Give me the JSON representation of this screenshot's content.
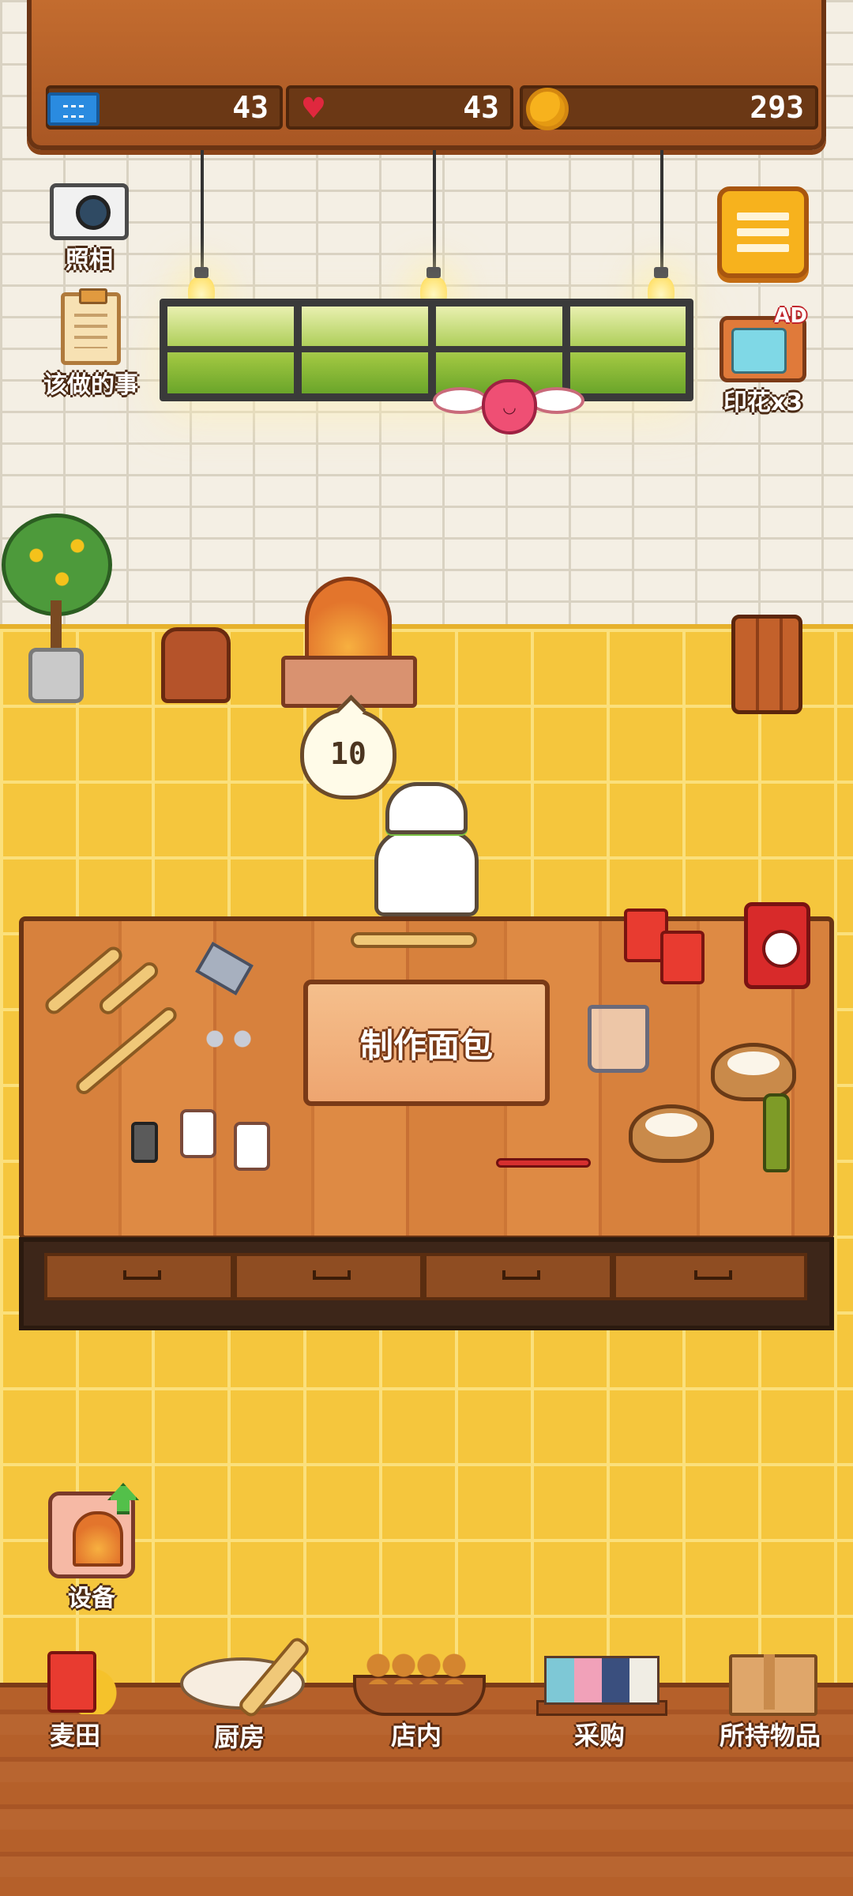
{
  "header": {
    "tickets": "43",
    "hearts": "43",
    "coins": "293"
  },
  "side_buttons": {
    "photo_label": "照相",
    "todo_label": "该做的事",
    "ad_badge": "AD",
    "stamps_label": "印花x3"
  },
  "oven_timer": "10",
  "main_action": {
    "label": "制作面包"
  },
  "equipment": {
    "label": "设备"
  },
  "nav": {
    "items": [
      {
        "label": "麦田",
        "icon": "wheat-field-icon"
      },
      {
        "label": "厨房",
        "icon": "kitchen-icon"
      },
      {
        "label": "店内",
        "icon": "store-icon"
      },
      {
        "label": "采购",
        "icon": "purchase-icon"
      },
      {
        "label": "所持物品",
        "icon": "inventory-icon"
      }
    ]
  },
  "icons": {
    "ticket": "ticket-icon",
    "heart": "heart-icon",
    "coin": "coin-icon",
    "camera": "camera-icon",
    "clipboard": "clipboard-icon",
    "menu": "menu-icon",
    "tv": "tv-ad-icon",
    "upgrade": "upgrade-arrow-icon"
  },
  "colors": {
    "board": "#b55f28",
    "floor": "#f5c63d",
    "menu_button": "#f7b21d",
    "heart": "#ef4f74",
    "ticket": "#2a8be0",
    "coin": "#f7b21d"
  }
}
